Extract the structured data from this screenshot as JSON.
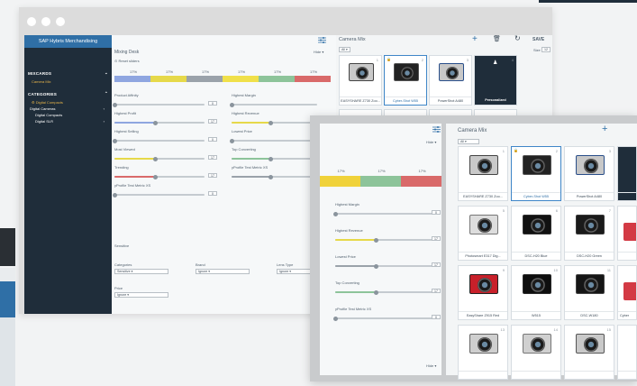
{
  "sidebar": {
    "app_title": "SAP Hybris Merchandising",
    "sections": [
      {
        "label": "MIXCARDS",
        "items": [
          {
            "label": "Camera Mix"
          }
        ]
      },
      {
        "label": "CATEGORIES",
        "items": [
          {
            "label": "Digital Compacts"
          },
          {
            "label": "Digital Cameras"
          },
          {
            "label": "Digital Compacts"
          },
          {
            "label": "Digital SLR"
          }
        ]
      }
    ]
  },
  "mixing_desk": {
    "title": "Mixing Desk",
    "hide_label": "Hide",
    "reset_label": "Reset sliders",
    "percent_bar": [
      "17%",
      "17%",
      "17%",
      "17%",
      "17%",
      "17%"
    ],
    "bar_colors": [
      "#8fa6e0",
      "#e6d94a",
      "#9aa2aa",
      "#f0e04a",
      "#8dc49a",
      "#d96a6a"
    ],
    "sliders_left": [
      {
        "label": "Product Affinity",
        "value": "0",
        "fill": 0.0,
        "color": "#8fa6e0"
      },
      {
        "label": "Highest Profit",
        "value": "17",
        "fill": 0.45,
        "color": "#8fa6e0"
      },
      {
        "label": "Highest Selling",
        "value": "0",
        "fill": 0.0,
        "color": "#9aa2aa"
      },
      {
        "label": "Most Viewed",
        "value": "17",
        "fill": 0.45,
        "color": "#e6d94a"
      },
      {
        "label": "Trending",
        "value": "17",
        "fill": 0.45,
        "color": "#d96a6a"
      },
      {
        "label": "yProfile Test Metric XS",
        "value": "0",
        "fill": 0.0,
        "color": "#9aa2aa"
      }
    ],
    "sliders_right": [
      {
        "label": "Highest Margin",
        "value": "",
        "fill": 0.0,
        "color": "#9aa2aa"
      },
      {
        "label": "Highest Revenue",
        "value": "",
        "fill": 0.45,
        "color": "#e6d94a"
      },
      {
        "label": "Lowest Price",
        "value": "",
        "fill": 0.0,
        "color": "#9aa2aa"
      },
      {
        "label": "Top Converting",
        "value": "",
        "fill": 0.45,
        "color": "#8dc49a"
      },
      {
        "label": "yProfile Test Metric XS",
        "value": "",
        "fill": 0.45,
        "color": "#9aa2aa"
      }
    ],
    "sensitive_label": "Sensitive",
    "filters": [
      {
        "label": "Categories",
        "value": "Sensitive"
      },
      {
        "label": "Brand",
        "value": "Ignore"
      },
      {
        "label": "Lens Type",
        "value": "Ignore"
      },
      {
        "label": "Price",
        "value": "Ignore"
      }
    ]
  },
  "camera_mix_back": {
    "title": "Camera Mix",
    "filter": "All",
    "save_label": "SAVE",
    "size_label": "Size",
    "size_value": "12",
    "cards": [
      {
        "num": "1",
        "caption": "EASYSHARE Z730 Zoo..."
      },
      {
        "num": "2",
        "caption": "Cyber-Shot W55"
      },
      {
        "num": "3",
        "caption": "PowerShot A480"
      },
      {
        "num": "4",
        "caption": "Personalized"
      }
    ]
  },
  "overlay": {
    "hide_label": "Hide",
    "percent_bar": [
      "17%",
      "17%",
      "17%"
    ],
    "bar_colors": [
      "#f0d23a",
      "#8dc49a",
      "#d96a6a"
    ],
    "sliders": [
      {
        "label": "Highest Margin",
        "value": "0",
        "fill": 0.0,
        "color": "#9aa2aa"
      },
      {
        "label": "Highest Revenue",
        "value": "17",
        "fill": 0.42,
        "color": "#e6d94a"
      },
      {
        "label": "Lowest Price",
        "value": "17",
        "fill": 0.42,
        "color": "#9aa2aa"
      },
      {
        "label": "Top Converting",
        "value": "17",
        "fill": 0.42,
        "color": "#8dc49a"
      },
      {
        "label": "yProfile Test Metric XS",
        "value": "0",
        "fill": 0.0,
        "color": "#9aa2aa"
      }
    ],
    "camera_mix": {
      "title": "Camera Mix",
      "filter": "All",
      "cards": [
        {
          "num": "1",
          "caption": "EASYSHARE Z730 Zoo..."
        },
        {
          "num": "2",
          "caption": "Cyber-Shot W55"
        },
        {
          "num": "3",
          "caption": "PowerShot A480"
        },
        {
          "num": "5",
          "caption": "Photosmart E317 Dig..."
        },
        {
          "num": "6",
          "caption": "DSC-H20 Blue"
        },
        {
          "num": "7",
          "caption": "DSC-H20 Green"
        },
        {
          "num": "9",
          "caption": "EasyShare Z915 Red"
        },
        {
          "num": "10",
          "caption": "W515"
        },
        {
          "num": "11",
          "caption": "DSC-W180"
        },
        {
          "num": "13",
          "caption": ""
        },
        {
          "num": "14",
          "caption": ""
        },
        {
          "num": "15",
          "caption": ""
        }
      ],
      "edge_cards": [
        {
          "caption": ""
        },
        {
          "caption": ""
        },
        {
          "caption": "Cyber"
        },
        {
          "caption": ""
        }
      ]
    }
  }
}
